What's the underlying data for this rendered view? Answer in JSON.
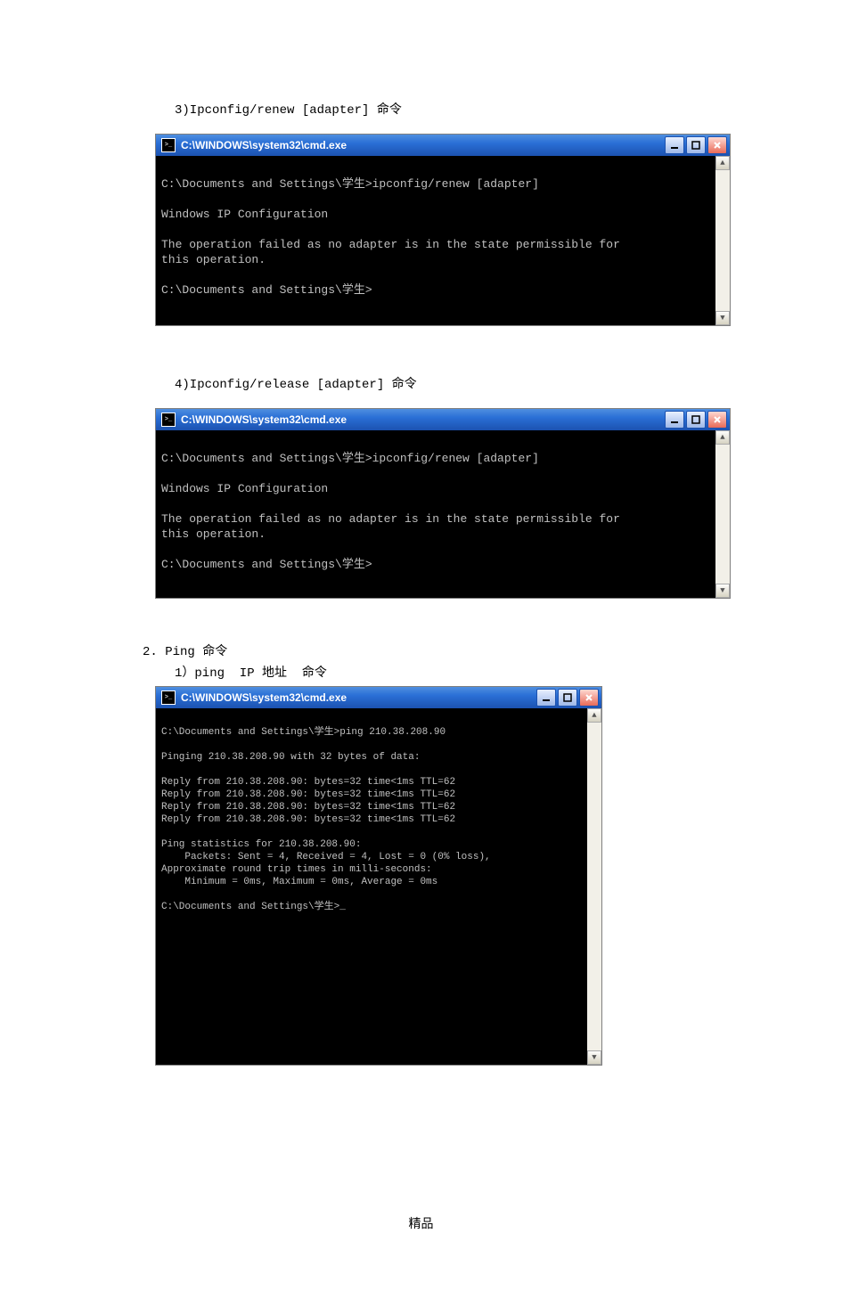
{
  "page": {
    "dot": ".",
    "footer": "精品"
  },
  "sections": {
    "s3_label": "3)Ipconfig/renew [adapter] 命令",
    "s4_label": "4)Ipconfig/release [adapter] 命令",
    "s_ping_head": "2. Ping 命令",
    "s_ping_sub": "1）ping  IP 地址  命令"
  },
  "window_title": "C:\\WINDOWS\\system32\\cmd.exe",
  "win_icon_name": "cmd-icon",
  "buttons": {
    "minimize": "_",
    "maximize": "▢",
    "close": "×"
  },
  "terminals": {
    "renew": [
      "",
      "C:\\Documents and Settings\\学生>ipconfig/renew [adapter]",
      "",
      "Windows IP Configuration",
      "",
      "The operation failed as no adapter is in the state permissible for",
      "this operation.",
      "",
      "C:\\Documents and Settings\\学生>",
      "",
      ""
    ],
    "release": [
      "",
      "C:\\Documents and Settings\\学生>ipconfig/renew [adapter]",
      "",
      "Windows IP Configuration",
      "",
      "The operation failed as no adapter is in the state permissible for",
      "this operation.",
      "",
      "C:\\Documents and Settings\\学生>",
      "",
      ""
    ],
    "ping": [
      "",
      "C:\\Documents and Settings\\学生>ping 210.38.208.90",
      "",
      "Pinging 210.38.208.90 with 32 bytes of data:",
      "",
      "Reply from 210.38.208.90: bytes=32 time<1ms TTL=62",
      "Reply from 210.38.208.90: bytes=32 time<1ms TTL=62",
      "Reply from 210.38.208.90: bytes=32 time<1ms TTL=62",
      "Reply from 210.38.208.90: bytes=32 time<1ms TTL=62",
      "",
      "Ping statistics for 210.38.208.90:",
      "    Packets: Sent = 4, Received = 4, Lost = 0 (0% loss),",
      "Approximate round trip times in milli-seconds:",
      "    Minimum = 0ms, Maximum = 0ms, Average = 0ms",
      "",
      "C:\\Documents and Settings\\学生>_",
      "",
      "",
      "",
      "",
      "",
      "",
      "",
      "",
      "",
      "",
      ""
    ]
  },
  "heights": {
    "win1_body": 190,
    "win2_body": 188,
    "win3_body": 400
  }
}
